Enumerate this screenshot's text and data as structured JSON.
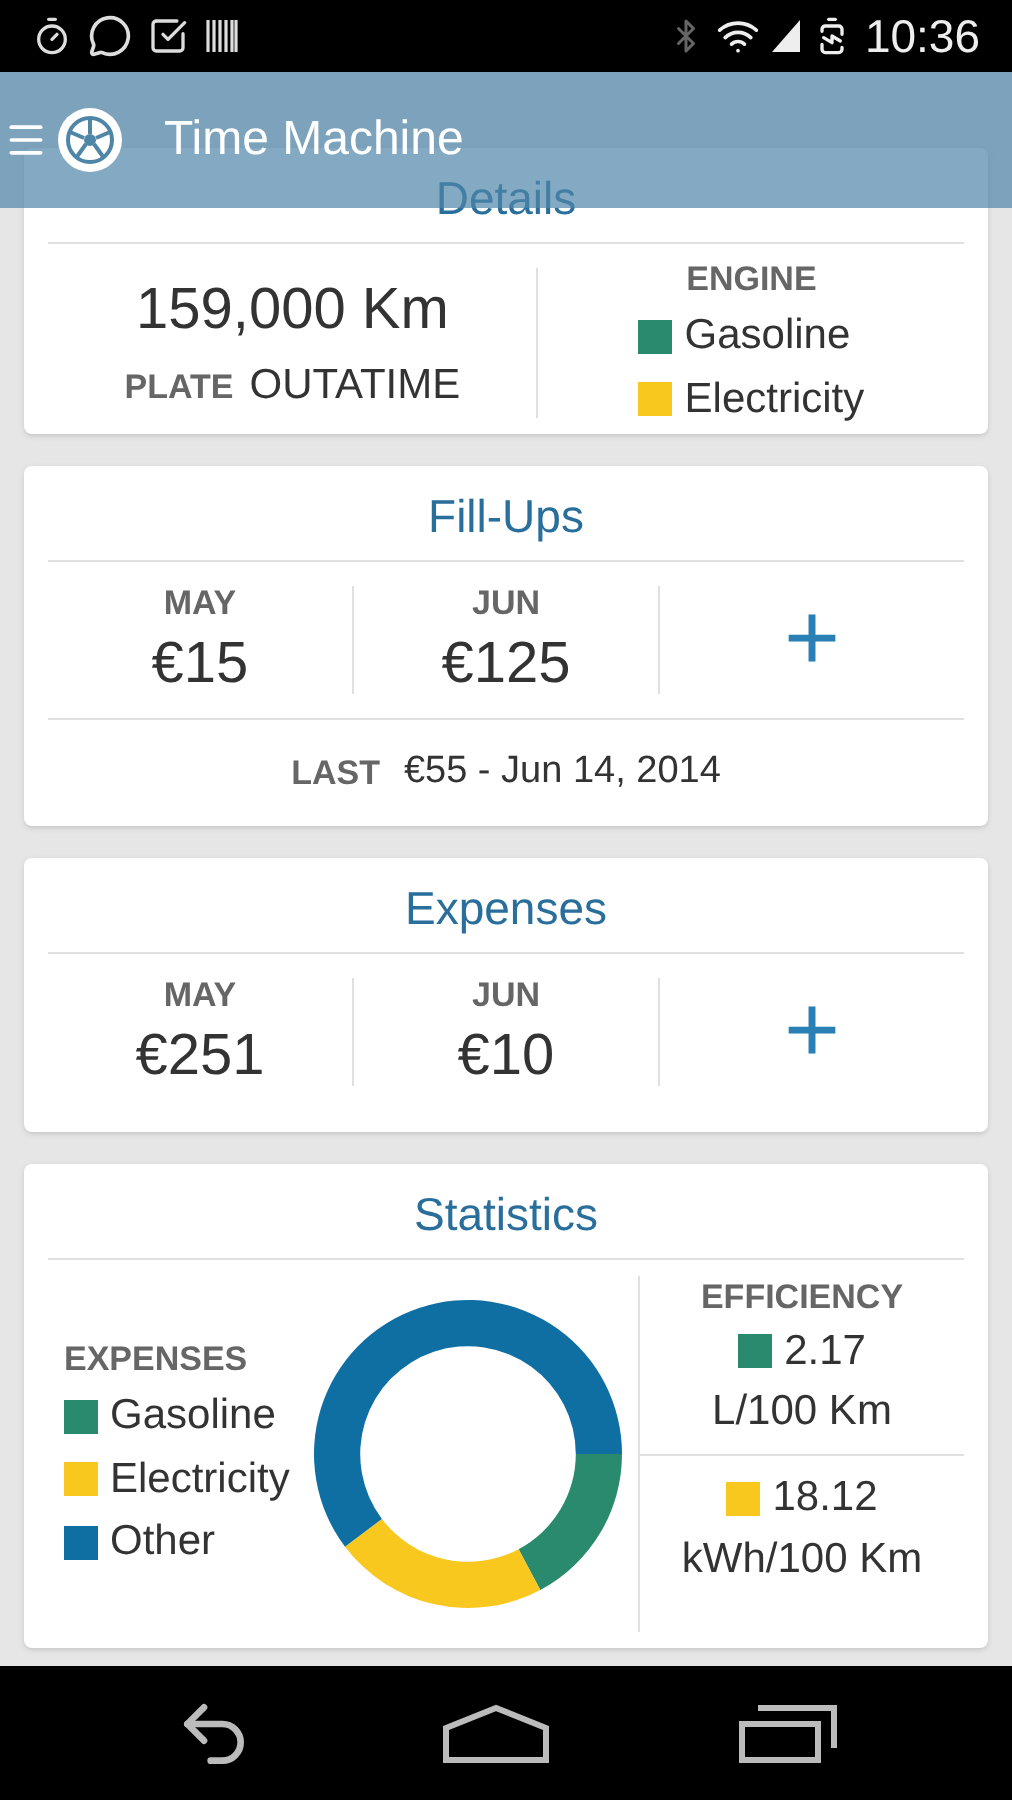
{
  "status_bar": {
    "time": "10:36"
  },
  "app_bar": {
    "title": "Time Machine"
  },
  "details": {
    "title": "Details",
    "odometer": "159,000 Km",
    "plate_label": "PLATE",
    "plate": "OUTATIME",
    "engine_label": "ENGINE",
    "engines": [
      {
        "name": "Gasoline",
        "color": "#2a8a6e"
      },
      {
        "name": "Electricity",
        "color": "#f9c81e"
      }
    ]
  },
  "fill_ups": {
    "title": "Fill-Ups",
    "months": [
      {
        "month": "MAY",
        "amount": "€15"
      },
      {
        "month": "JUN",
        "amount": "€125"
      }
    ],
    "add": "+",
    "last_label": "LAST",
    "last": "€55 - Jun 14, 2014"
  },
  "expenses": {
    "title": "Expenses",
    "months": [
      {
        "month": "MAY",
        "amount": "€251"
      },
      {
        "month": "JUN",
        "amount": "€10"
      }
    ],
    "add": "+"
  },
  "statistics": {
    "title": "Statistics",
    "expenses_label": "EXPENSES",
    "legend": [
      {
        "name": "Gasoline",
        "color": "#2a8a6e"
      },
      {
        "name": "Electricity",
        "color": "#f9c81e"
      },
      {
        "name": "Other",
        "color": "#0f6fa3"
      }
    ],
    "efficiency_label": "EFFICIENCY",
    "efficiency": [
      {
        "value": "2.17",
        "unit": "L/100 Km",
        "color": "#2a8a6e"
      },
      {
        "value": "18.12",
        "unit": "kWh/100 Km",
        "color": "#f9c81e"
      }
    ]
  }
}
